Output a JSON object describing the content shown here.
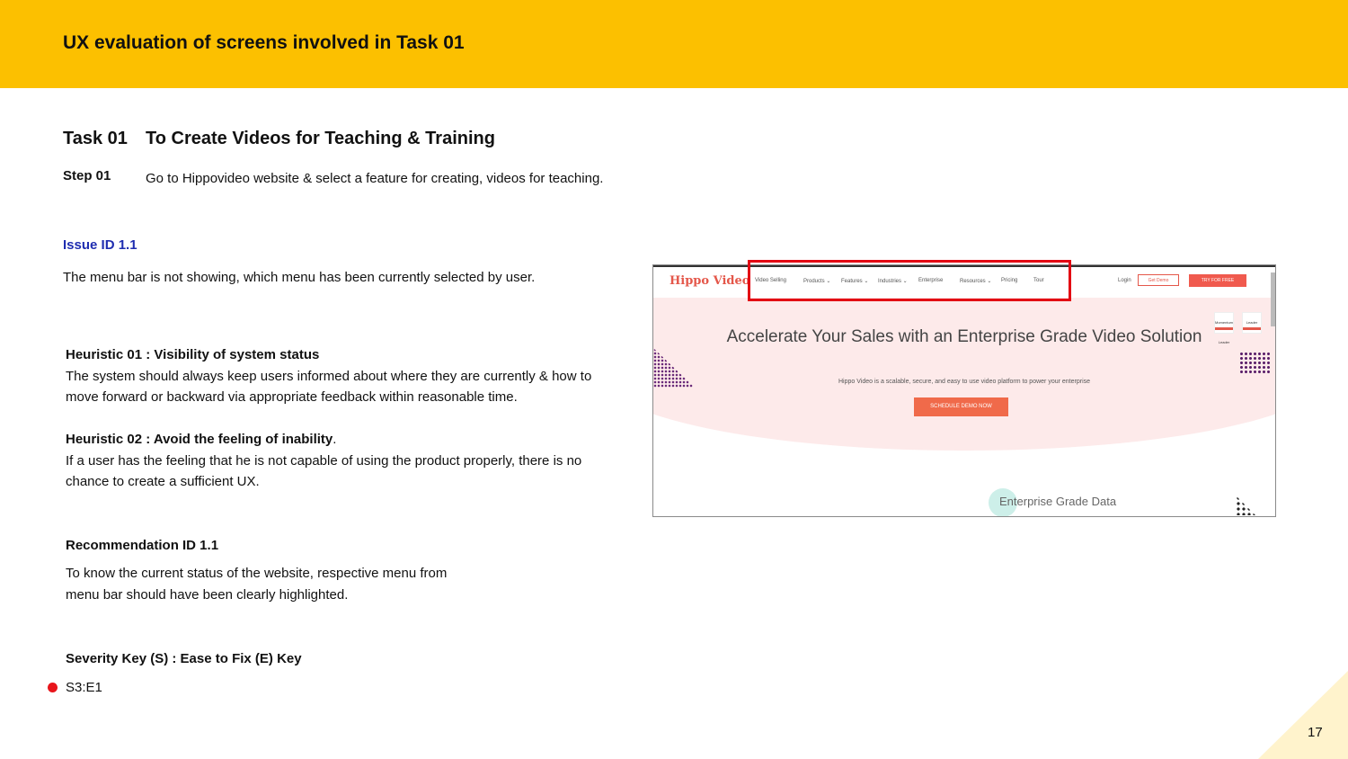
{
  "header": {
    "title": "UX evaluation of screens involved in Task 01"
  },
  "task": {
    "number": "Task 01",
    "title": "To Create Videos for Teaching & Training"
  },
  "step": {
    "label": "Step 01",
    "text": "Go to Hippovideo website & select a feature for creating, videos for teaching."
  },
  "issue": {
    "id": "Issue ID 1.1",
    "text": "The menu bar is not showing, which menu has been currently selected by user."
  },
  "heuristics": [
    {
      "title": "Heuristic 01 : Visibility of system status",
      "suffix": "",
      "text": "The system should always keep users informed about where they are currently & how to move forward or backward via appropriate feedback within reasonable time."
    },
    {
      "title": "Heuristic 02 : Avoid the feeling of inability",
      "suffix": ".",
      "text": "If a user has the feeling that he is not capable of using the product properly, there is no chance to create a sufficient UX."
    }
  ],
  "recommendation": {
    "title": "Recommendation ID 1.1",
    "text": "To know the current status of the website, respective menu from menu bar should have been clearly highlighted."
  },
  "severity": {
    "title": "Severity Key (S) : Ease to Fix (E) Key",
    "value": "S3:E1",
    "dot_color": "#E8151B"
  },
  "page_number": "17",
  "screenshot": {
    "logo": "Hippo Video",
    "nav": [
      "Video Selling",
      "Products ⌄",
      "Features ⌄",
      "Industries ⌄",
      "Enterprise",
      "Resources ⌄",
      "Pricing",
      "Tour"
    ],
    "login": "Login",
    "get_demo": "Get Demo",
    "try_free": "TRY FOR FREE",
    "badge_left": "Momentum Leader",
    "badge_right": "Leader",
    "hero_title": "Accelerate Your Sales with an Enterprise Grade Video Solution",
    "hero_sub": "Hippo Video is a scalable, secure, and easy to use video platform to power your enterprise",
    "cta": "SCHEDULE DEMO NOW",
    "section": "Enterprise Grade Data"
  },
  "colors": {
    "header": "#FCC000",
    "issue_id": "#1F2DB0",
    "highlight": "#E30613"
  }
}
